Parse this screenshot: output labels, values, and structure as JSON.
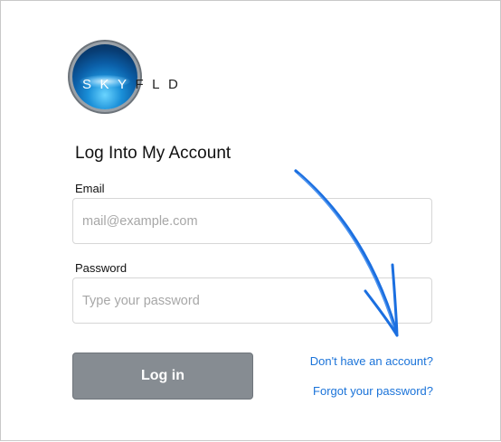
{
  "logo": {
    "text_in_orb": "SKY",
    "text_out_orb": "FLD"
  },
  "title": "Log Into My Account",
  "email": {
    "label": "Email",
    "placeholder": "mail@example.com",
    "value": ""
  },
  "password": {
    "label": "Password",
    "placeholder": "Type your password",
    "value": ""
  },
  "login_button_label": "Log in",
  "links": {
    "signup": "Don't have an account?",
    "forgot_password": "Forgot your password?"
  },
  "colors": {
    "link": "#1a73d9",
    "button": "#868c92",
    "annotation_arrow": "#1b6fe0"
  },
  "annotation": {
    "icon": "hand-drawn-arrow-icon"
  }
}
